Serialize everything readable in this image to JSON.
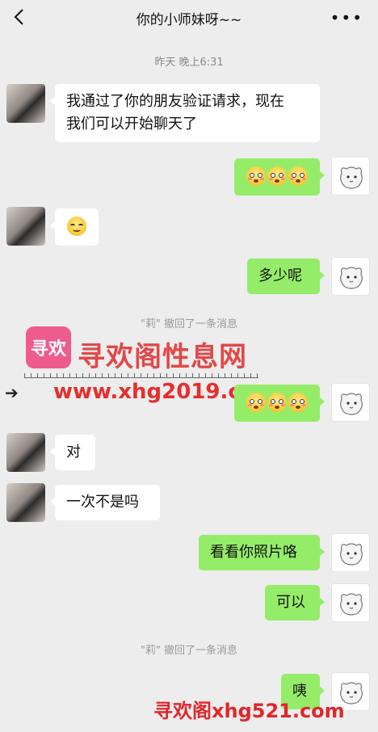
{
  "header": {
    "title": "你的小师妹呀~~",
    "back_icon": "chevron-left-icon",
    "more_icon": "more-dots-icon"
  },
  "timestamp": "昨天 晚上6:31",
  "messages": [
    {
      "side": "left",
      "text_line1": "我通过了你的朋友验证请求，现在",
      "text_line2": "我们可以开始聊天了"
    },
    {
      "side": "right",
      "emoji": "flushed-face x3"
    },
    {
      "side": "left",
      "emoji": "smiling-face"
    },
    {
      "side": "right",
      "text": "多少呢"
    },
    {
      "side": "right",
      "emoji": "flushed-face x3"
    },
    {
      "side": "left",
      "text": "对"
    },
    {
      "side": "left",
      "text": "一次不是吗"
    },
    {
      "side": "right",
      "text": "看看你照片咯"
    },
    {
      "side": "right",
      "text": "可以"
    },
    {
      "side": "right",
      "text": "咦"
    }
  ],
  "system_messages": [
    "\"莉\" 撤回了一条消息",
    "\"莉\" 撤回了一条消息"
  ],
  "watermark": {
    "logo": "寻欢",
    "name": "寻欢阁性息网",
    "url": "www.xhg2019.com",
    "bottom": "寻欢阁xhg521.com"
  },
  "colors": {
    "bg": "#ededed",
    "sent_bubble": "#95ec69",
    "received_bubble": "#ffffff",
    "watermark_red": "#e23b3b"
  }
}
